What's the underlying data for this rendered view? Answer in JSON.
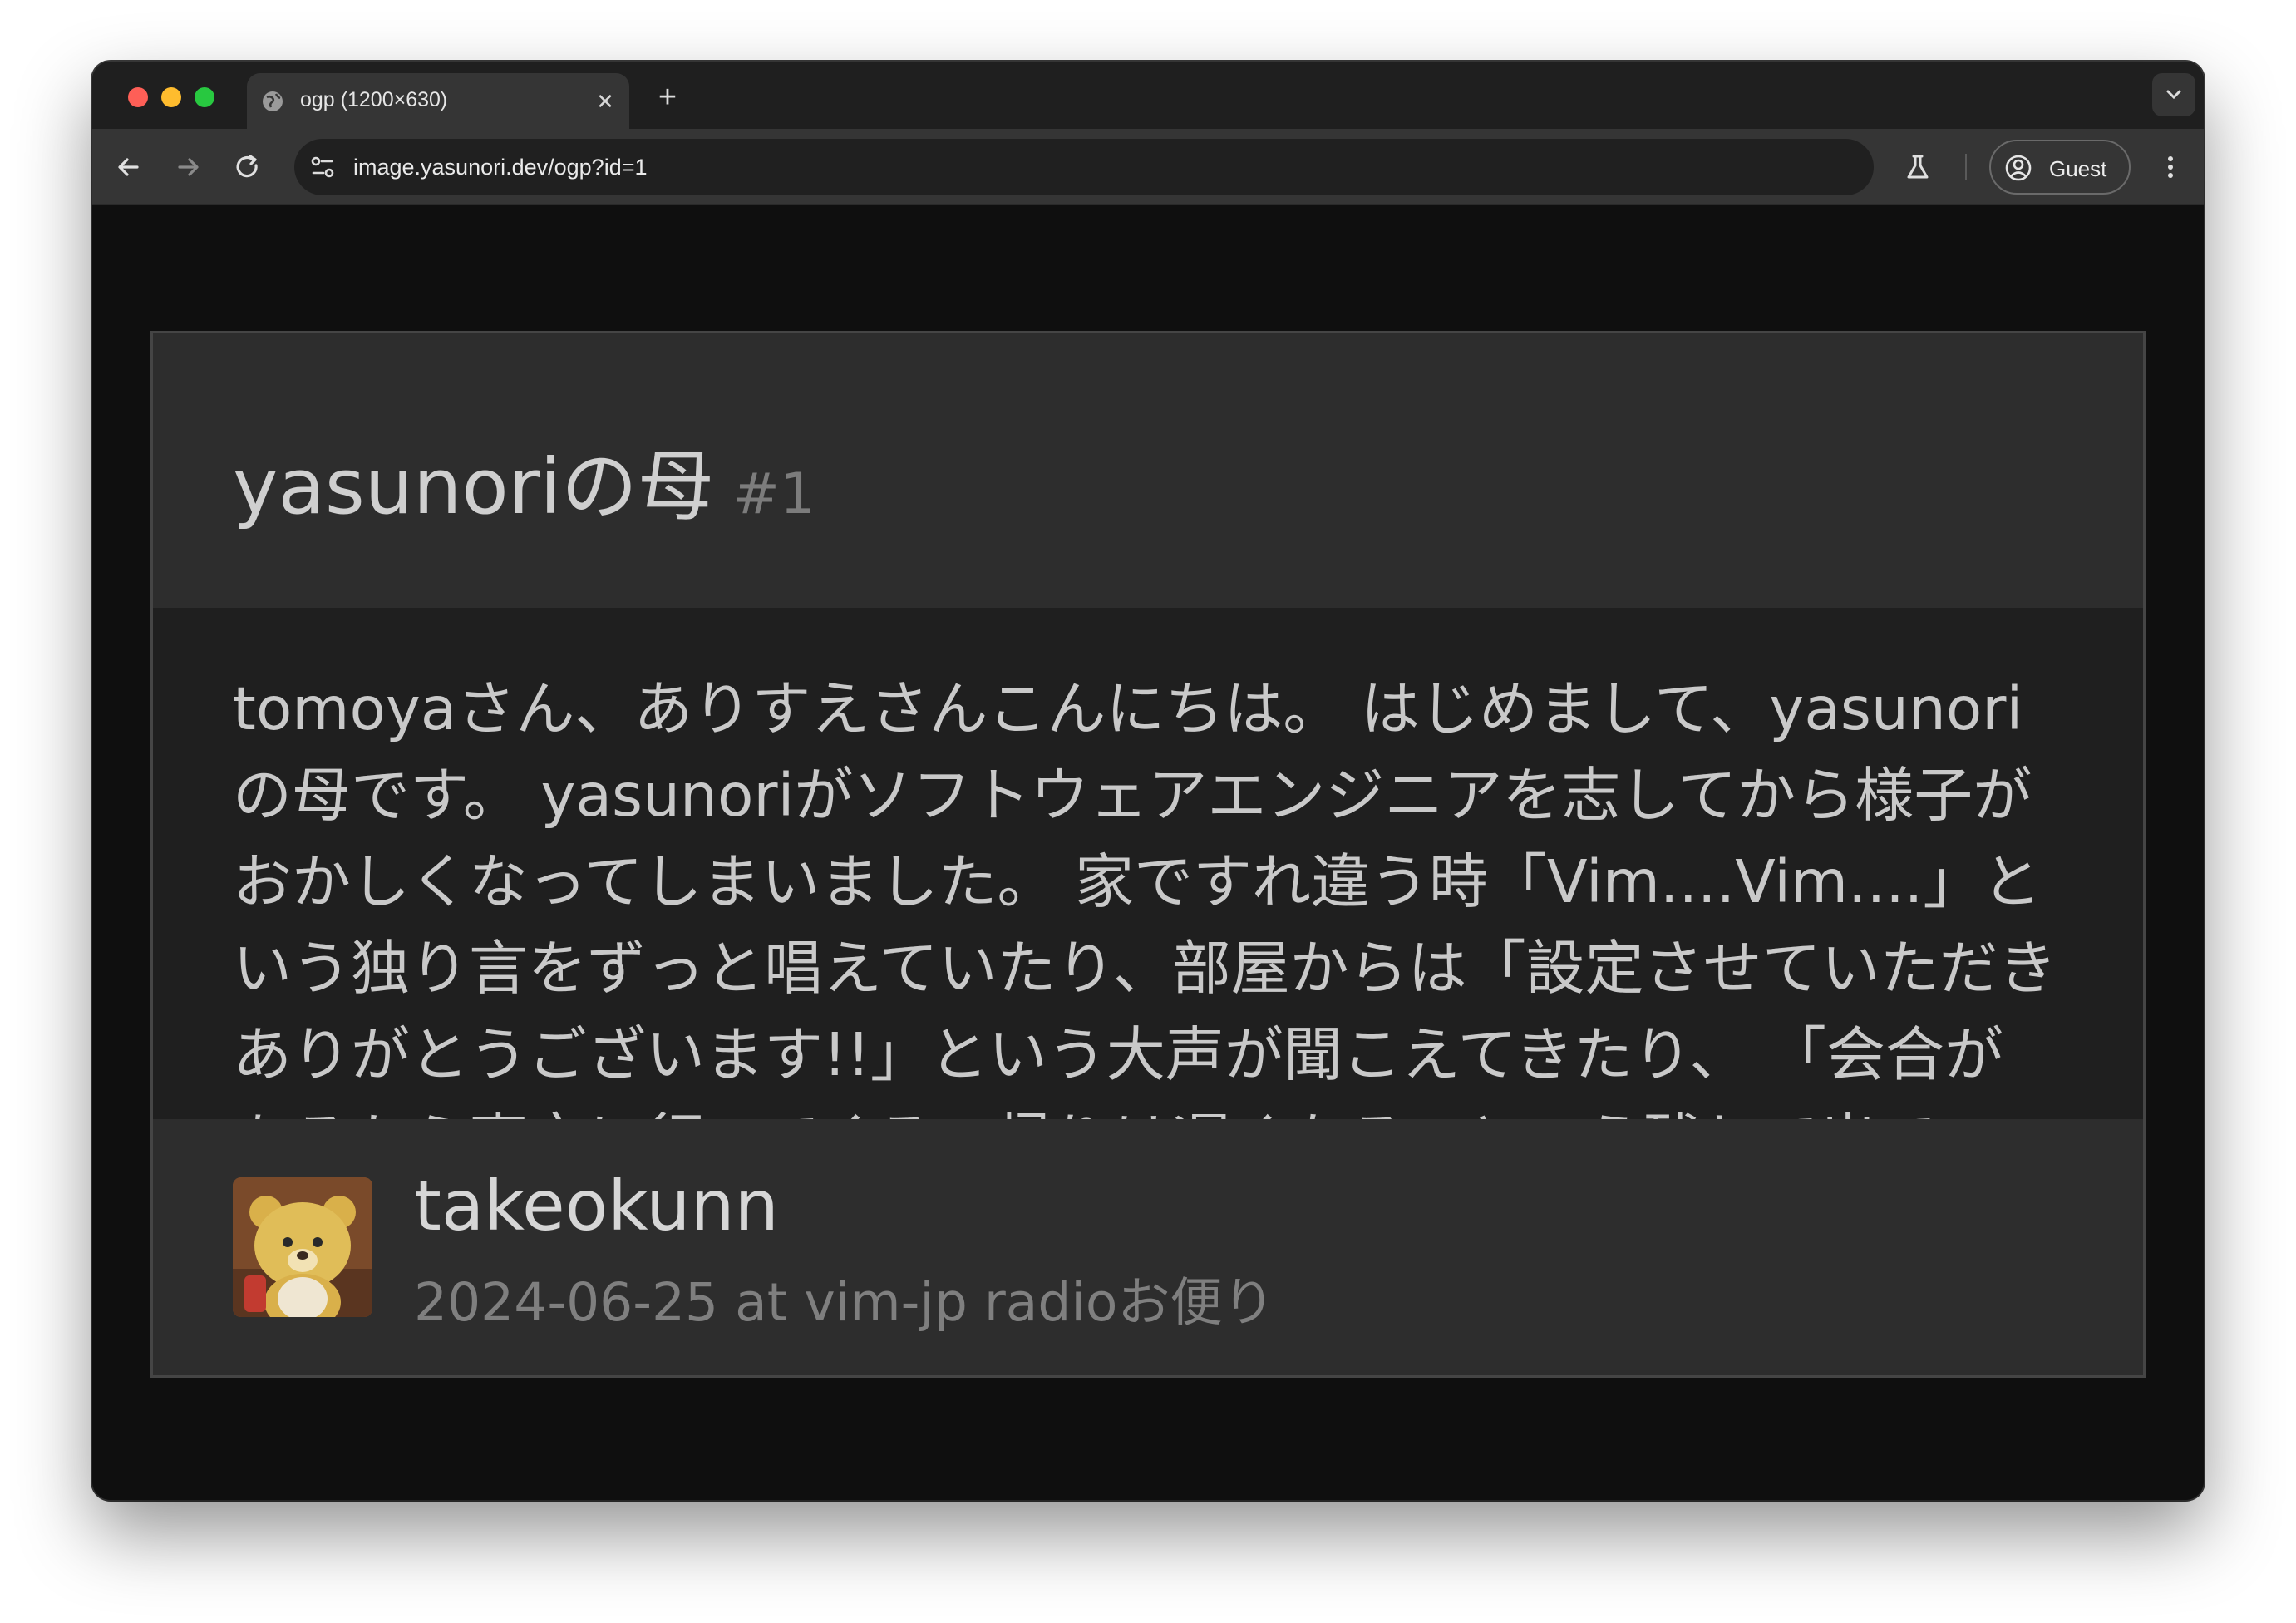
{
  "browser": {
    "tab_title": "ogp (1200×630)",
    "url": "image.yasunori.dev/ogp?id=1",
    "profile_label": "Guest"
  },
  "card": {
    "title": "yasunoriの母",
    "number": "#1",
    "body": "tomoyaさん、ありすえさんこんにちは。 はじめまして、yasunoriの母です。 yasunoriがソフトウェアエンジニアを志してから様子がおかしくなってしまいました。 家ですれ違う時「Vim....Vim....」という独り言をずっと唱えていたり、部屋からは「設定させていただきありがとうございます!!」という大声が聞こえてきたり、 「会合があるから東京に行ってくる、帰りは遅くなる」という残して出て",
    "author": "takeokunn",
    "meta": "2024-06-25 at vim-jp radioお便り"
  }
}
